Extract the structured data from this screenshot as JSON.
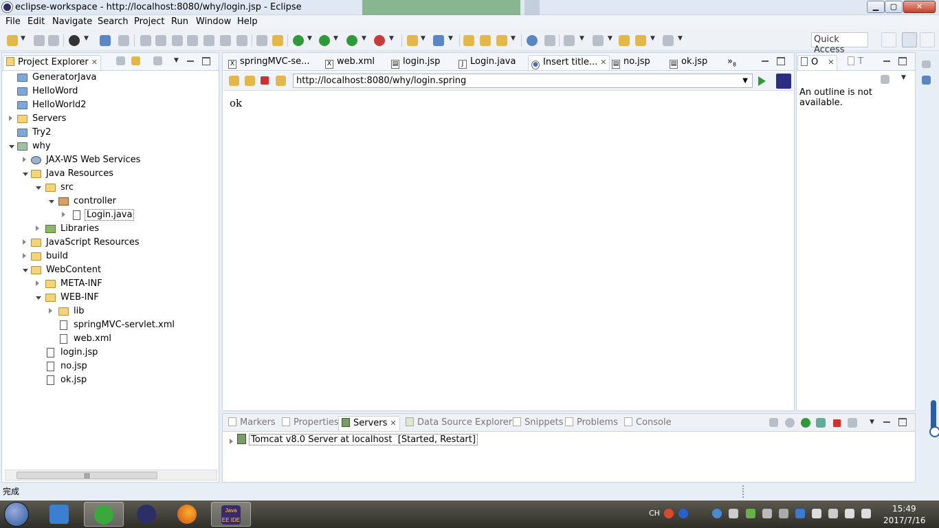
{
  "window": {
    "title": "eclipse-workspace - http://localhost:8080/why/login.jsp - Eclipse",
    "controls": {
      "minimize": "▁",
      "maximize": "▢",
      "close": "✕"
    }
  },
  "menu": [
    "File",
    "Edit",
    "Navigate",
    "Search",
    "Project",
    "Run",
    "Window",
    "Help"
  ],
  "toolbar": {
    "quick_access": "Quick Access"
  },
  "explorer": {
    "title": "Project Explorer",
    "close_glyph": "✕",
    "scroll_glyph": "|||",
    "tree": [
      {
        "label": "GeneratorJava",
        "icon": "project-icon"
      },
      {
        "label": "HelloWord",
        "icon": "project-icon"
      },
      {
        "label": "HelloWorld2",
        "icon": "project-icon"
      },
      {
        "label": "Servers",
        "icon": "folder-icon"
      },
      {
        "label": "Try2",
        "icon": "project-icon"
      },
      {
        "label": "why",
        "icon": "web-project-icon"
      },
      {
        "label": "JAX-WS Web Services",
        "icon": "web-services-icon"
      },
      {
        "label": "Java Resources",
        "icon": "java-resources-icon"
      },
      {
        "label": "src",
        "icon": "source-folder-icon"
      },
      {
        "label": "controller",
        "icon": "package-icon"
      },
      {
        "label": "Login.java",
        "icon": "java-file-icon"
      },
      {
        "label": "Libraries",
        "icon": "libraries-icon"
      },
      {
        "label": "JavaScript Resources",
        "icon": "js-resources-icon"
      },
      {
        "label": "build",
        "icon": "folder-icon"
      },
      {
        "label": "WebContent",
        "icon": "folder-icon"
      },
      {
        "label": "META-INF",
        "icon": "folder-icon"
      },
      {
        "label": "WEB-INF",
        "icon": "folder-icon"
      },
      {
        "label": "lib",
        "icon": "folder-icon"
      },
      {
        "label": "springMVC-servlet.xml",
        "icon": "xml-file-icon"
      },
      {
        "label": "web.xml",
        "icon": "xml-file-icon"
      },
      {
        "label": "login.jsp",
        "icon": "jsp-file-icon"
      },
      {
        "label": "no.jsp",
        "icon": "jsp-file-icon"
      },
      {
        "label": "ok.jsp",
        "icon": "jsp-file-icon"
      }
    ]
  },
  "editor": {
    "tabs": [
      "springMVC-se...",
      "web.xml",
      "login.jsp",
      "Login.java",
      "Insert title...",
      "no.jsp",
      "ok.jsp"
    ],
    "tab_glyphs": [
      "X",
      "X",
      "▤",
      "J",
      "●",
      "▤",
      "▤"
    ],
    "tab_close_glyph": "✕",
    "overflow": "»",
    "overflow_count": "8",
    "url": "http://localhost:8080/why/login.spring",
    "url_drop_glyph": "▼",
    "content": "ok"
  },
  "outline": {
    "tabs": [
      "O",
      "T"
    ],
    "close_glyph": "✕",
    "message": "An outline is not available."
  },
  "bottom": {
    "tabs": [
      "Markers",
      "Properties",
      "Servers",
      "Data Source Explorer",
      "Snippets",
      "Problems",
      "Console"
    ],
    "close_glyph": "✕",
    "server_name": "Tomcat v8.0 Server at localhost",
    "server_state": "[Started, Restart]"
  },
  "status": {
    "message": "完成"
  },
  "taskbar": {
    "ime": "CH",
    "time": "15:49",
    "date": "2017/7/16",
    "java_app_label": "Java EE IDE"
  }
}
